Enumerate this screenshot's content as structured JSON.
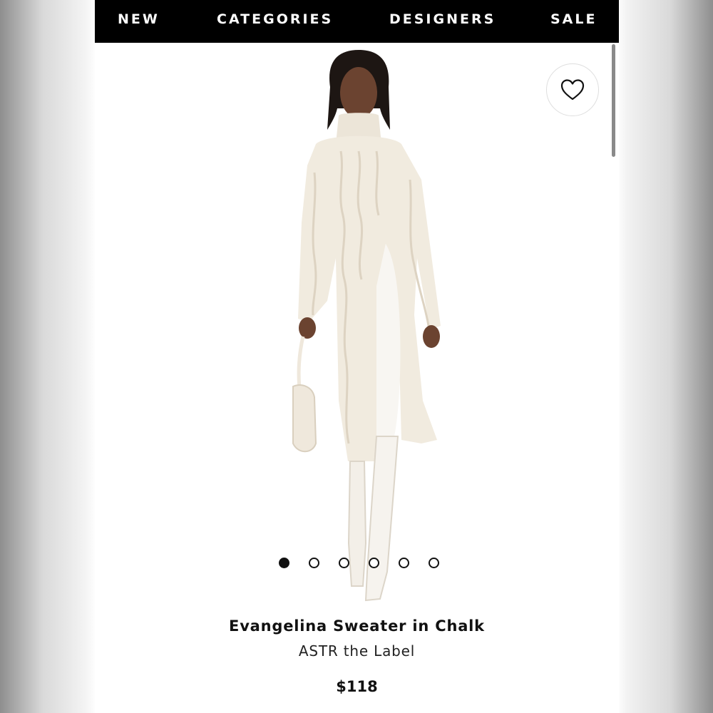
{
  "nav": {
    "items": [
      "NEW",
      "CATEGORIES",
      "DESIGNERS",
      "SALE"
    ]
  },
  "wishlist": {
    "icon": "heart-icon"
  },
  "carousel": {
    "total_slides": 6,
    "active_index": 0
  },
  "product": {
    "title": "Evangelina Sweater in Chalk",
    "brand": "ASTR the Label",
    "price": "$118"
  },
  "colors": {
    "nav_background": "#000000",
    "nav_text": "#ffffff",
    "page_background": "#ffffff",
    "sweater": "#f1ebdf",
    "text": "#111111"
  }
}
